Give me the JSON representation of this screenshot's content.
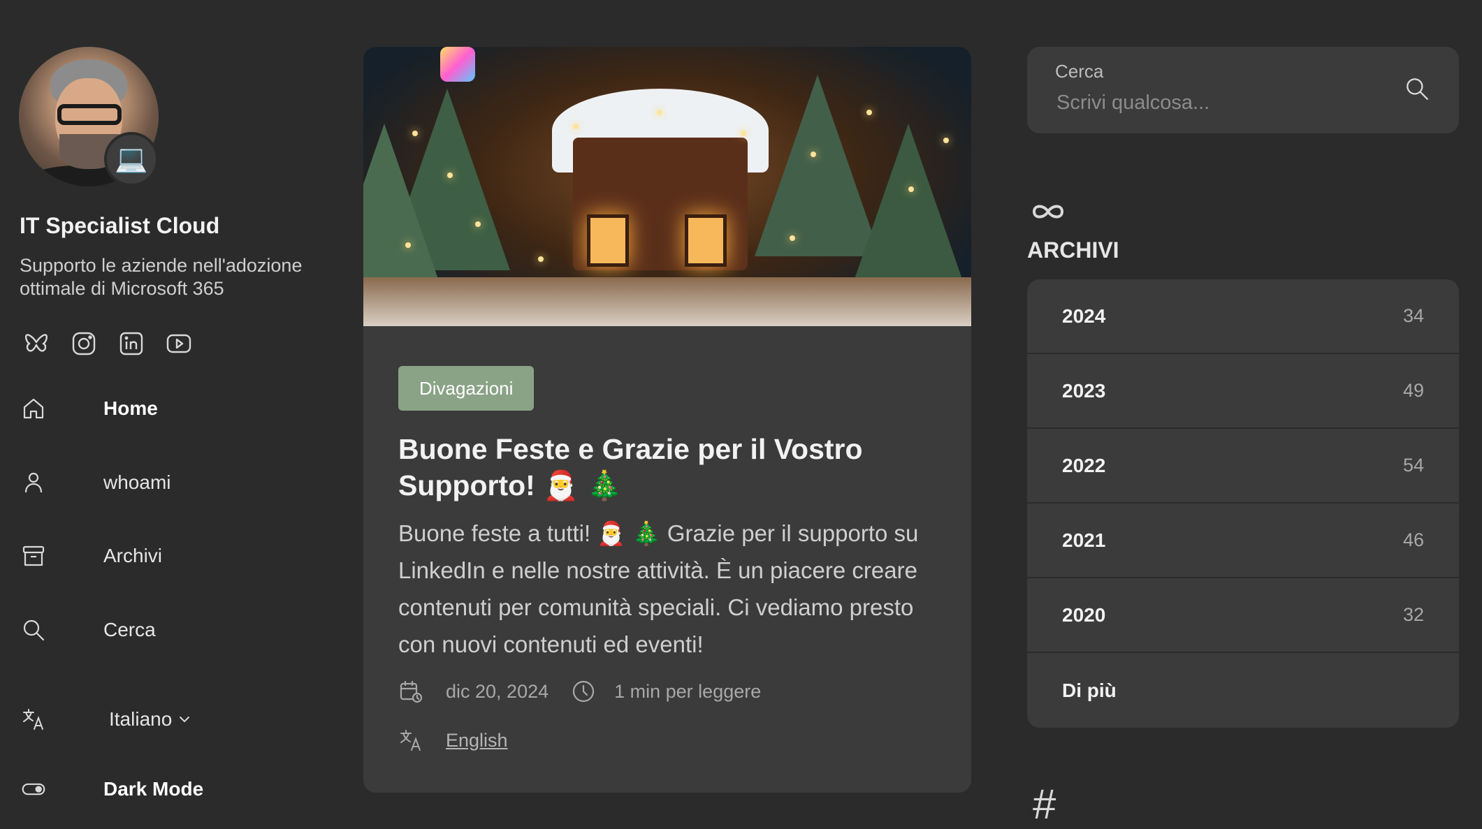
{
  "sidebar": {
    "site_title": "IT Specialist Cloud",
    "site_subtitle": "Supporto le aziende nell'adozione ottimale di Microsoft 365",
    "avatar_badge_icon": "laptop-emoji",
    "avatar_badge_glyph": "💻",
    "social": [
      {
        "name": "bluesky-icon"
      },
      {
        "name": "instagram-icon"
      },
      {
        "name": "linkedin-icon"
      },
      {
        "name": "youtube-icon"
      }
    ],
    "nav": {
      "home": "Home",
      "whoami": "whoami",
      "archivi": "Archivi",
      "cerca": "Cerca",
      "language": "Italiano",
      "dark_mode": "Dark Mode"
    }
  },
  "post": {
    "tag": "Divagazioni",
    "title": "Buone Feste e Grazie per il Vostro Supporto! 🎅 🎄",
    "excerpt": "Buone feste a tutti! 🎅 🎄 Grazie per il supporto su LinkedIn e nelle nostre attività. È un piacere creare contenuti per comunità speciali. Ci vediamo presto con nuovi contenuti ed eventi!",
    "date": "dic 20, 2024",
    "read_time": "1 min per leggere",
    "translation_link": "English",
    "image_description": "christmas-cabin-illustration"
  },
  "search": {
    "label": "Cerca",
    "placeholder": "Scrivi qualcosa..."
  },
  "archive": {
    "heading": "ARCHIVI",
    "years": [
      {
        "year": "2024",
        "count": "34"
      },
      {
        "year": "2023",
        "count": "49"
      },
      {
        "year": "2022",
        "count": "54"
      },
      {
        "year": "2021",
        "count": "46"
      },
      {
        "year": "2020",
        "count": "32"
      }
    ],
    "more": "Di più"
  },
  "tags_icon_glyph": "#",
  "colors": {
    "background": "#2b2b2b",
    "card": "#3b3b3b",
    "tag": "#8aa386",
    "text": "#e6e6e6",
    "muted": "#a8a8a8"
  }
}
